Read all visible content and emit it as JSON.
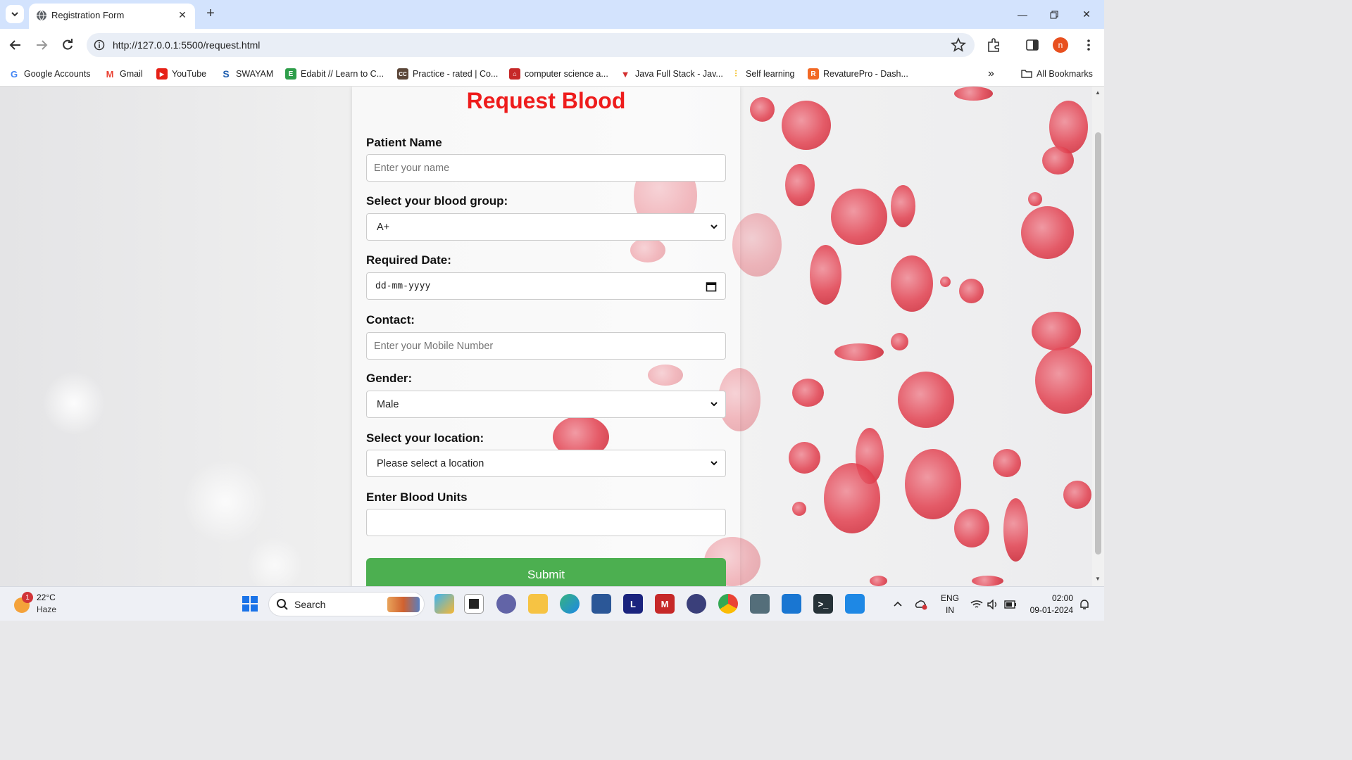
{
  "browser": {
    "tab_title": "Registration Form",
    "url": "http://127.0.0.1:5500/request.html",
    "profile_initial": "n"
  },
  "bookmarks": [
    {
      "label": "Google Accounts",
      "icon": "google-icon"
    },
    {
      "label": "Gmail",
      "icon": "gmail-icon"
    },
    {
      "label": "YouTube",
      "icon": "youtube-icon"
    },
    {
      "label": "SWAYAM",
      "icon": "swayam-icon"
    },
    {
      "label": "Edabit // Learn to C...",
      "icon": "edabit-icon"
    },
    {
      "label": "Practice - rated | Co...",
      "icon": "codechef-icon"
    },
    {
      "label": "computer science a...",
      "icon": "bookmark-site-icon"
    },
    {
      "label": "Java Full Stack - Jav...",
      "icon": "java-fullstack-icon"
    },
    {
      "label": "Self learning",
      "icon": "self-learning-icon"
    },
    {
      "label": "RevaturePro - Dash...",
      "icon": "revature-icon"
    }
  ],
  "all_bookmarks_label": "All Bookmarks",
  "form": {
    "title": "Request Blood",
    "patient_name_label": "Patient Name",
    "patient_name_placeholder": "Enter your name",
    "blood_group_label": "Select your blood group:",
    "blood_group_value": "A+",
    "required_date_label": "Required Date:",
    "required_date_placeholder": "dd-mm-yyyy",
    "contact_label": "Contact:",
    "contact_placeholder": "Enter your Mobile Number",
    "gender_label": "Gender:",
    "gender_value": "Male",
    "location_label": "Select your location:",
    "location_value": "Please select a location",
    "units_label": "Enter Blood Units",
    "units_value": "",
    "submit_label": "Submit"
  },
  "taskbar": {
    "weather_temp": "22°C",
    "weather_desc": "Haze",
    "weather_badge": "1",
    "search_label": "Search",
    "lang_line1": "ENG",
    "lang_line2": "IN",
    "time": "02:00",
    "date": "09-01-2024"
  },
  "colors": {
    "title_red": "#ee1c1c",
    "submit_green": "#4caf50",
    "tabstrip_blue": "#d3e3fd"
  }
}
